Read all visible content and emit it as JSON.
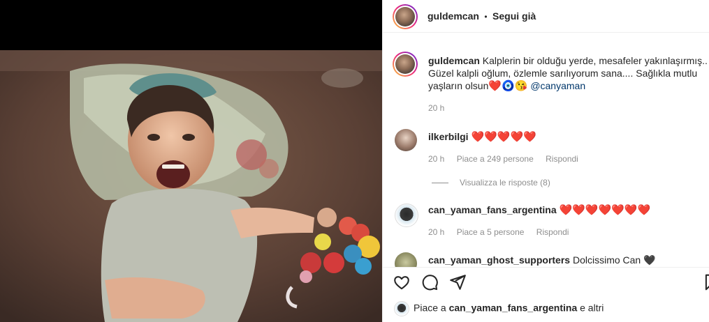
{
  "post": {
    "author": "guldemcan",
    "dot": "•",
    "follow_state": "Segui già",
    "caption_user": "guldemcan",
    "caption_line1": "Kalplerin bir olduğu yerde, mesafeler yakınlaşırmış..",
    "caption_line2": "Güzel kalpli oğlum, özlemle sarılıyorum sana.... Sağlıkla mutlu",
    "caption_line3": "yaşların olsun",
    "caption_emojis": "❤️🧿😘",
    "caption_mention": "@canyaman",
    "caption_time": "20 h"
  },
  "comments": [
    {
      "user": "ilkerbilgi",
      "text": "❤️❤️❤️❤️❤️",
      "time": "20 h",
      "likes": "Piace a 249 persone",
      "reply": "Rispondi",
      "view_replies": "Visualizza le risposte (8)"
    },
    {
      "user": "can_yaman_fans_argentina",
      "text": "❤️❤️❤️❤️❤️❤️❤️",
      "time": "20 h",
      "likes": "Piace a 5 persone",
      "reply": "Rispondi"
    },
    {
      "user": "can_yaman_ghost_supporters",
      "text": "Dolcissimo Can 🖤"
    }
  ],
  "footer": {
    "liked_prefix": "Piace a",
    "liked_user": "can_yaman_fans_argentina",
    "liked_suffix": "e altri"
  },
  "icons": {
    "like": "heart-outline-icon",
    "comment": "comment-bubble-icon",
    "share": "paper-plane-icon",
    "save": "bookmark-icon"
  },
  "colors": {
    "heart_red": "#ed1c24",
    "mention_blue": "#00376b",
    "muted": "#8e8e8e"
  }
}
